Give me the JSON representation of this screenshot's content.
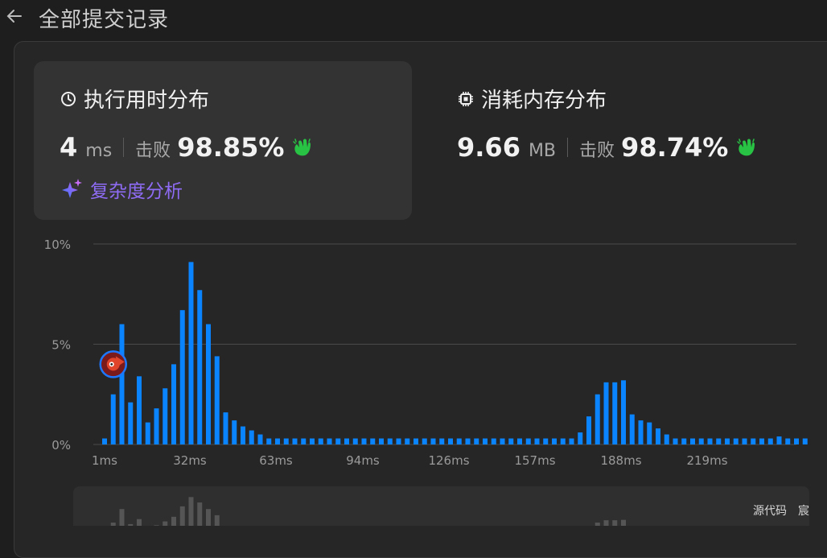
{
  "header": {
    "title": "全部提交记录"
  },
  "runtime": {
    "title": "执行用时分布",
    "value": "4",
    "unit": "ms",
    "beat_label": "击败",
    "beat_pct": "98.85%",
    "analysis_label": "复杂度分析"
  },
  "memory": {
    "title": "消耗内存分布",
    "value": "9.66",
    "unit": "MB",
    "beat_label": "击败",
    "beat_pct": "98.74%"
  },
  "footer": {
    "source_code": "源代码",
    "user": "宸"
  },
  "colors": {
    "bar": "#0a84ff",
    "accent_purple": "#8f6cf5",
    "clap_green": "#28c244"
  },
  "chart_data": {
    "type": "bar",
    "y_tick_labels": [
      "10%",
      "5%",
      "0%"
    ],
    "ylim": [
      0,
      10
    ],
    "x_tick_labels": [
      "1ms",
      "32ms",
      "63ms",
      "94ms",
      "126ms",
      "157ms",
      "188ms",
      "219ms"
    ],
    "values": [
      0.3,
      2.5,
      6.0,
      2.1,
      3.4,
      1.1,
      1.8,
      2.8,
      4.0,
      6.7,
      9.1,
      7.7,
      6.0,
      4.4,
      1.6,
      1.2,
      0.9,
      0.7,
      0.5,
      0.3,
      0.3,
      0.3,
      0.3,
      0.3,
      0.3,
      0.3,
      0.3,
      0.3,
      0.3,
      0.3,
      0.3,
      0.3,
      0.3,
      0.3,
      0.3,
      0.3,
      0.3,
      0.3,
      0.3,
      0.3,
      0.3,
      0.3,
      0.3,
      0.3,
      0.3,
      0.3,
      0.3,
      0.3,
      0.3,
      0.3,
      0.3,
      0.3,
      0.3,
      0.3,
      0.3,
      0.6,
      1.4,
      2.5,
      3.1,
      3.1,
      3.2,
      1.5,
      1.2,
      1.1,
      0.8,
      0.5,
      0.3,
      0.3,
      0.3,
      0.3,
      0.3,
      0.3,
      0.3,
      0.3,
      0.3,
      0.3,
      0.3,
      0.3,
      0.4,
      0.3,
      0.3,
      0.3
    ],
    "highlight_index": 1,
    "highlight_value": 4.0
  }
}
